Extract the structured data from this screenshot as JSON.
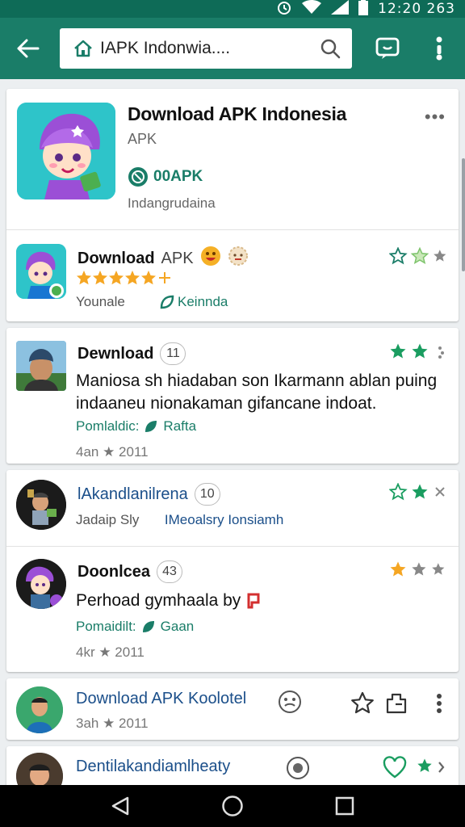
{
  "status_bar": {
    "clock": "12:20 263"
  },
  "app_bar": {
    "search_text": "IAPK Indonwia...."
  },
  "hero": {
    "title": "Download APK Indonesia",
    "subtitle": "APK",
    "badge": "00APK",
    "description": "Indangrudaina"
  },
  "items": [
    {
      "title": "Download",
      "title_light": "APK",
      "stars": 5,
      "meta_left": "Younale",
      "meta_right": "Keinnda"
    },
    {
      "title": "Dewnload",
      "badge": "11",
      "body_line1": "Maniosa sh hiadaban son Ikarmann ablan puing",
      "body_line2": "indaaneu nionakaman gifancane indoat.",
      "meta_left": "Pomlaldic:",
      "meta_right": "Rafta",
      "footer": "4an ★ 2011"
    },
    {
      "title": "lAkandlanilrena",
      "badge": "10",
      "meta_left": "Jadaip Sly",
      "meta_right": "IMeoalsry Ionsiamh"
    },
    {
      "title": "Doonlcea",
      "badge": "43",
      "body_line1": "Perhoad gymhaala by",
      "meta_left": "Pomaidilt:",
      "meta_right": "Gaan",
      "footer": "4kr ★ 2011"
    },
    {
      "title": "Download APK Koolotel",
      "footer": "3ah ★ 2011"
    },
    {
      "title": "Dentilakandiamlheaty"
    }
  ],
  "colors": {
    "primary": "#1a7d68",
    "status_bar": "#0e6b57",
    "star": "#f5a623",
    "link_blue": "#1b4f8a"
  }
}
